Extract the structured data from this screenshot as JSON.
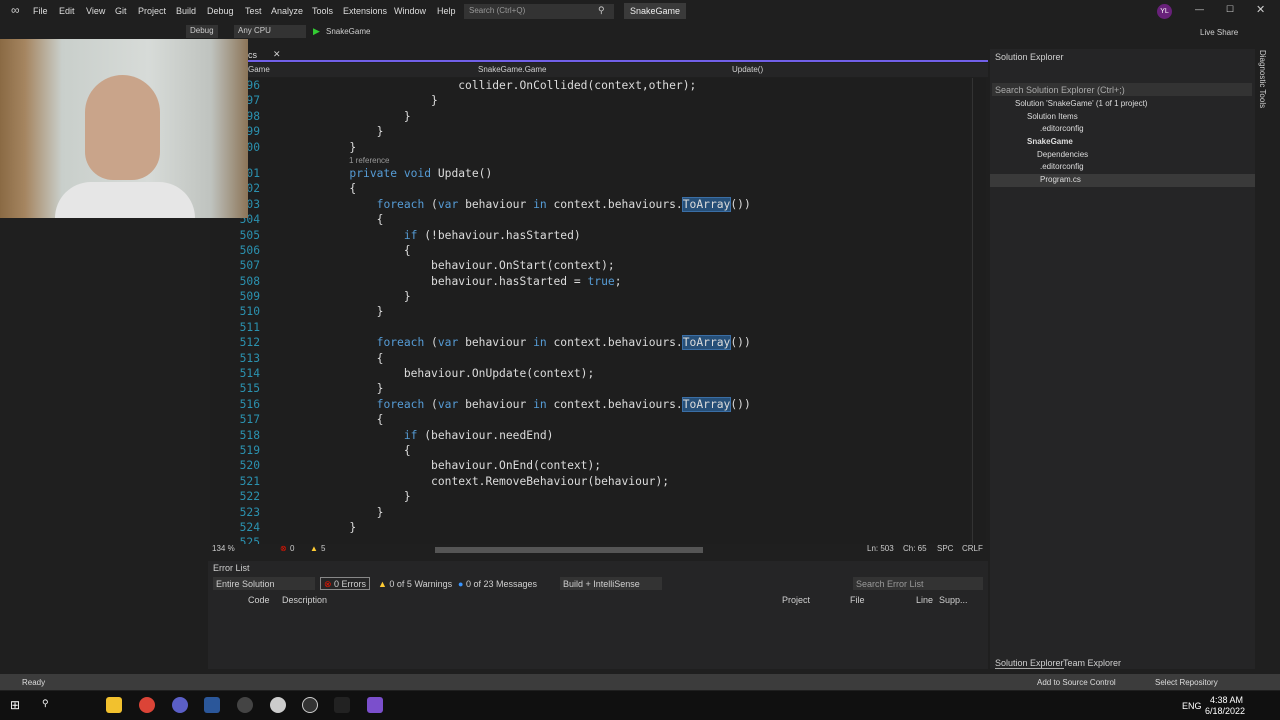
{
  "menu": [
    "File",
    "Edit",
    "View",
    "Git",
    "Project",
    "Build",
    "Debug",
    "Test",
    "Analyze",
    "Tools",
    "Extensions",
    "Window",
    "Help"
  ],
  "search_placeholder": "Search (Ctrl+Q)",
  "app_title": "SnakeGame",
  "user_initials": "YL",
  "live_share": "Live Share",
  "toolbar": {
    "config": "Debug",
    "platform": "Any CPU",
    "run": "SnakeGame"
  },
  "tab_partial": "cs",
  "nav": {
    "project": "Game",
    "class": "SnakeGame.Game",
    "member": "Update()"
  },
  "codelens": "1 reference",
  "code": [
    {
      "n": "496",
      "t": [
        [
          "                ",
          ""
        ],
        [
          "collider.OnCollided(context,other);",
          ""
        ]
      ]
    },
    {
      "n": "497",
      "t": [
        [
          "            }",
          ""
        ]
      ]
    },
    {
      "n": "498",
      "t": [
        [
          "        }",
          ""
        ]
      ]
    },
    {
      "n": "499",
      "t": [
        [
          "    }",
          ""
        ]
      ]
    },
    {
      "n": "500",
      "t": [
        [
          "}",
          ""
        ]
      ]
    },
    {
      "n": "501",
      "t": [
        [
          "private void",
          "kw"
        ],
        [
          " Update()",
          ""
        ]
      ]
    },
    {
      "n": "502",
      "t": [
        [
          "{",
          ""
        ]
      ]
    },
    {
      "n": "503",
      "t": [
        [
          "    ",
          ""
        ],
        [
          "foreach",
          "kw"
        ],
        [
          " (",
          ""
        ],
        [
          "var",
          "kw"
        ],
        [
          " behaviour ",
          ""
        ],
        [
          "in",
          "kw"
        ],
        [
          " context.behaviours.",
          ""
        ],
        [
          "ToArray",
          "hl"
        ],
        [
          "())",
          ""
        ]
      ]
    },
    {
      "n": "504",
      "t": [
        [
          "    {",
          ""
        ]
      ]
    },
    {
      "n": "505",
      "t": [
        [
          "        ",
          ""
        ],
        [
          "if",
          "kw"
        ],
        [
          " (!behaviour.hasStarted)",
          ""
        ]
      ]
    },
    {
      "n": "506",
      "t": [
        [
          "        {",
          ""
        ]
      ]
    },
    {
      "n": "507",
      "t": [
        [
          "            behaviour.OnStart(context);",
          ""
        ]
      ]
    },
    {
      "n": "508",
      "t": [
        [
          "            behaviour.hasStarted = ",
          ""
        ],
        [
          "true",
          "kw"
        ],
        [
          ";",
          ""
        ]
      ]
    },
    {
      "n": "509",
      "t": [
        [
          "        }",
          ""
        ]
      ]
    },
    {
      "n": "510",
      "t": [
        [
          "    }",
          ""
        ]
      ]
    },
    {
      "n": "511",
      "t": [
        [
          "",
          ""
        ]
      ]
    },
    {
      "n": "512",
      "t": [
        [
          "    ",
          ""
        ],
        [
          "foreach",
          "kw"
        ],
        [
          " (",
          ""
        ],
        [
          "var",
          "kw"
        ],
        [
          " behaviour ",
          ""
        ],
        [
          "in",
          "kw"
        ],
        [
          " context.behaviours.",
          ""
        ],
        [
          "ToArray",
          "hl"
        ],
        [
          "())",
          ""
        ]
      ]
    },
    {
      "n": "513",
      "t": [
        [
          "    {",
          ""
        ]
      ]
    },
    {
      "n": "514",
      "t": [
        [
          "        behaviour.OnUpdate(context);",
          ""
        ]
      ]
    },
    {
      "n": "515",
      "t": [
        [
          "    }",
          ""
        ]
      ]
    },
    {
      "n": "516",
      "t": [
        [
          "    ",
          ""
        ],
        [
          "foreach",
          "kw"
        ],
        [
          " (",
          ""
        ],
        [
          "var",
          "kw"
        ],
        [
          " behaviour ",
          ""
        ],
        [
          "in",
          "kw"
        ],
        [
          " context.behaviours.",
          ""
        ],
        [
          "ToArray",
          "hl"
        ],
        [
          "())",
          ""
        ]
      ]
    },
    {
      "n": "517",
      "t": [
        [
          "    {",
          ""
        ]
      ]
    },
    {
      "n": "518",
      "t": [
        [
          "        ",
          ""
        ],
        [
          "if",
          "kw"
        ],
        [
          " (behaviour.needEnd)",
          ""
        ]
      ]
    },
    {
      "n": "519",
      "t": [
        [
          "        {",
          ""
        ]
      ]
    },
    {
      "n": "520",
      "t": [
        [
          "            behaviour.OnEnd(context);",
          ""
        ]
      ]
    },
    {
      "n": "521",
      "t": [
        [
          "            context.RemoveBehaviour(behaviour);",
          ""
        ]
      ]
    },
    {
      "n": "522",
      "t": [
        [
          "        }",
          ""
        ]
      ]
    },
    {
      "n": "523",
      "t": [
        [
          "    }",
          ""
        ]
      ]
    },
    {
      "n": "524",
      "t": [
        [
          "}",
          ""
        ]
      ]
    },
    {
      "n": "525",
      "t": [
        [
          "",
          ""
        ]
      ]
    }
  ],
  "editor_status": {
    "zoom": "134 %",
    "errors": "0",
    "warnings": "5",
    "ln": "Ln: 503",
    "ch": "Ch: 65",
    "spc": "SPC",
    "eol": "CRLF"
  },
  "error_list": {
    "title": "Error List",
    "scope": "Entire Solution",
    "errors": "0 Errors",
    "warnings": "0 of 5 Warnings",
    "messages": "0 of 23 Messages",
    "source": "Build + IntelliSense",
    "search": "Search Error List",
    "columns": [
      "Code",
      "Description",
      "Project",
      "File",
      "Line",
      "Supp..."
    ]
  },
  "solution_explorer": {
    "title": "Solution Explorer",
    "search": "Search Solution Explorer (Ctrl+;)",
    "items": [
      "Solution 'SnakeGame' (1 of 1 project)",
      "Solution Items",
      ".editorconfig",
      "SnakeGame",
      "Dependencies",
      ".editorconfig",
      "Program.cs"
    ],
    "tabs": [
      "Solution Explorer",
      "Team Explorer"
    ],
    "side_tab": "Diagnostic Tools"
  },
  "status": {
    "ready": "Ready",
    "source_control": "Add to Source Control",
    "repo": "Select Repository"
  },
  "taskbar": {
    "time": "4:38 AM",
    "date": "6/18/2022",
    "lang": "ENG"
  }
}
